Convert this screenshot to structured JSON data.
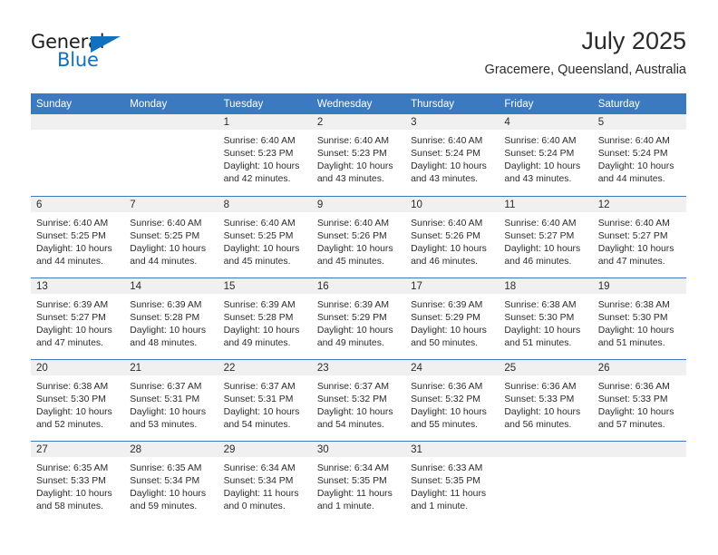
{
  "brand": {
    "name_top": "General",
    "name_bottom": "Blue",
    "color_dark": "#1d1d1d",
    "color_blue": "#1271bf"
  },
  "header": {
    "title": "July 2025",
    "subtitle": "Gracemere, Queensland, Australia"
  },
  "theme": {
    "header_blue": "#3b7ac0",
    "daynum_gray": "#f0f0f0",
    "text": "#2b2b2b"
  },
  "calendar": {
    "weekdays": [
      "Sunday",
      "Monday",
      "Tuesday",
      "Wednesday",
      "Thursday",
      "Friday",
      "Saturday"
    ],
    "weeks": [
      [
        {
          "day": "",
          "sunrise": "",
          "sunset": "",
          "daylight": ""
        },
        {
          "day": "",
          "sunrise": "",
          "sunset": "",
          "daylight": ""
        },
        {
          "day": "1",
          "sunrise": "Sunrise: 6:40 AM",
          "sunset": "Sunset: 5:23 PM",
          "daylight": "Daylight: 10 hours and 42 minutes."
        },
        {
          "day": "2",
          "sunrise": "Sunrise: 6:40 AM",
          "sunset": "Sunset: 5:23 PM",
          "daylight": "Daylight: 10 hours and 43 minutes."
        },
        {
          "day": "3",
          "sunrise": "Sunrise: 6:40 AM",
          "sunset": "Sunset: 5:24 PM",
          "daylight": "Daylight: 10 hours and 43 minutes."
        },
        {
          "day": "4",
          "sunrise": "Sunrise: 6:40 AM",
          "sunset": "Sunset: 5:24 PM",
          "daylight": "Daylight: 10 hours and 43 minutes."
        },
        {
          "day": "5",
          "sunrise": "Sunrise: 6:40 AM",
          "sunset": "Sunset: 5:24 PM",
          "daylight": "Daylight: 10 hours and 44 minutes."
        }
      ],
      [
        {
          "day": "6",
          "sunrise": "Sunrise: 6:40 AM",
          "sunset": "Sunset: 5:25 PM",
          "daylight": "Daylight: 10 hours and 44 minutes."
        },
        {
          "day": "7",
          "sunrise": "Sunrise: 6:40 AM",
          "sunset": "Sunset: 5:25 PM",
          "daylight": "Daylight: 10 hours and 44 minutes."
        },
        {
          "day": "8",
          "sunrise": "Sunrise: 6:40 AM",
          "sunset": "Sunset: 5:25 PM",
          "daylight": "Daylight: 10 hours and 45 minutes."
        },
        {
          "day": "9",
          "sunrise": "Sunrise: 6:40 AM",
          "sunset": "Sunset: 5:26 PM",
          "daylight": "Daylight: 10 hours and 45 minutes."
        },
        {
          "day": "10",
          "sunrise": "Sunrise: 6:40 AM",
          "sunset": "Sunset: 5:26 PM",
          "daylight": "Daylight: 10 hours and 46 minutes."
        },
        {
          "day": "11",
          "sunrise": "Sunrise: 6:40 AM",
          "sunset": "Sunset: 5:27 PM",
          "daylight": "Daylight: 10 hours and 46 minutes."
        },
        {
          "day": "12",
          "sunrise": "Sunrise: 6:40 AM",
          "sunset": "Sunset: 5:27 PM",
          "daylight": "Daylight: 10 hours and 47 minutes."
        }
      ],
      [
        {
          "day": "13",
          "sunrise": "Sunrise: 6:39 AM",
          "sunset": "Sunset: 5:27 PM",
          "daylight": "Daylight: 10 hours and 47 minutes."
        },
        {
          "day": "14",
          "sunrise": "Sunrise: 6:39 AM",
          "sunset": "Sunset: 5:28 PM",
          "daylight": "Daylight: 10 hours and 48 minutes."
        },
        {
          "day": "15",
          "sunrise": "Sunrise: 6:39 AM",
          "sunset": "Sunset: 5:28 PM",
          "daylight": "Daylight: 10 hours and 49 minutes."
        },
        {
          "day": "16",
          "sunrise": "Sunrise: 6:39 AM",
          "sunset": "Sunset: 5:29 PM",
          "daylight": "Daylight: 10 hours and 49 minutes."
        },
        {
          "day": "17",
          "sunrise": "Sunrise: 6:39 AM",
          "sunset": "Sunset: 5:29 PM",
          "daylight": "Daylight: 10 hours and 50 minutes."
        },
        {
          "day": "18",
          "sunrise": "Sunrise: 6:38 AM",
          "sunset": "Sunset: 5:30 PM",
          "daylight": "Daylight: 10 hours and 51 minutes."
        },
        {
          "day": "19",
          "sunrise": "Sunrise: 6:38 AM",
          "sunset": "Sunset: 5:30 PM",
          "daylight": "Daylight: 10 hours and 51 minutes."
        }
      ],
      [
        {
          "day": "20",
          "sunrise": "Sunrise: 6:38 AM",
          "sunset": "Sunset: 5:30 PM",
          "daylight": "Daylight: 10 hours and 52 minutes."
        },
        {
          "day": "21",
          "sunrise": "Sunrise: 6:37 AM",
          "sunset": "Sunset: 5:31 PM",
          "daylight": "Daylight: 10 hours and 53 minutes."
        },
        {
          "day": "22",
          "sunrise": "Sunrise: 6:37 AM",
          "sunset": "Sunset: 5:31 PM",
          "daylight": "Daylight: 10 hours and 54 minutes."
        },
        {
          "day": "23",
          "sunrise": "Sunrise: 6:37 AM",
          "sunset": "Sunset: 5:32 PM",
          "daylight": "Daylight: 10 hours and 54 minutes."
        },
        {
          "day": "24",
          "sunrise": "Sunrise: 6:36 AM",
          "sunset": "Sunset: 5:32 PM",
          "daylight": "Daylight: 10 hours and 55 minutes."
        },
        {
          "day": "25",
          "sunrise": "Sunrise: 6:36 AM",
          "sunset": "Sunset: 5:33 PM",
          "daylight": "Daylight: 10 hours and 56 minutes."
        },
        {
          "day": "26",
          "sunrise": "Sunrise: 6:36 AM",
          "sunset": "Sunset: 5:33 PM",
          "daylight": "Daylight: 10 hours and 57 minutes."
        }
      ],
      [
        {
          "day": "27",
          "sunrise": "Sunrise: 6:35 AM",
          "sunset": "Sunset: 5:33 PM",
          "daylight": "Daylight: 10 hours and 58 minutes."
        },
        {
          "day": "28",
          "sunrise": "Sunrise: 6:35 AM",
          "sunset": "Sunset: 5:34 PM",
          "daylight": "Daylight: 10 hours and 59 minutes."
        },
        {
          "day": "29",
          "sunrise": "Sunrise: 6:34 AM",
          "sunset": "Sunset: 5:34 PM",
          "daylight": "Daylight: 11 hours and 0 minutes."
        },
        {
          "day": "30",
          "sunrise": "Sunrise: 6:34 AM",
          "sunset": "Sunset: 5:35 PM",
          "daylight": "Daylight: 11 hours and 1 minute."
        },
        {
          "day": "31",
          "sunrise": "Sunrise: 6:33 AM",
          "sunset": "Sunset: 5:35 PM",
          "daylight": "Daylight: 11 hours and 1 minute."
        },
        {
          "day": "",
          "sunrise": "",
          "sunset": "",
          "daylight": ""
        },
        {
          "day": "",
          "sunrise": "",
          "sunset": "",
          "daylight": ""
        }
      ]
    ]
  }
}
